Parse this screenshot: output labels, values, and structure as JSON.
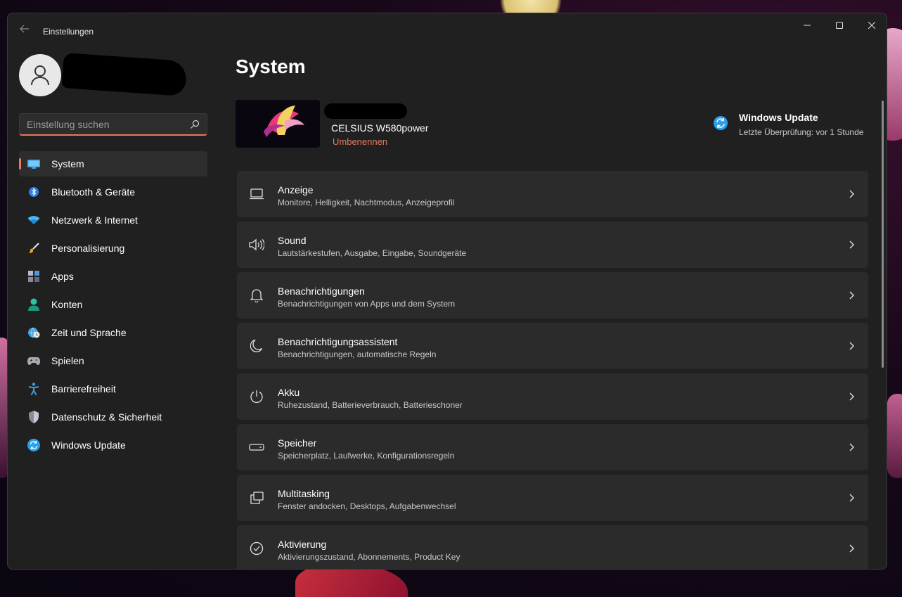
{
  "window": {
    "title": "Einstellungen"
  },
  "sidebar": {
    "search_placeholder": "Einstellung suchen",
    "items": [
      {
        "label": "System",
        "icon": "monitor-icon",
        "active": true
      },
      {
        "label": "Bluetooth & Geräte",
        "icon": "bluetooth-icon"
      },
      {
        "label": "Netzwerk & Internet",
        "icon": "wifi-icon"
      },
      {
        "label": "Personalisierung",
        "icon": "brush-icon"
      },
      {
        "label": "Apps",
        "icon": "apps-icon"
      },
      {
        "label": "Konten",
        "icon": "person-icon"
      },
      {
        "label": "Zeit und Sprache",
        "icon": "globe-clock-icon"
      },
      {
        "label": "Spielen",
        "icon": "gamepad-icon"
      },
      {
        "label": "Barrierefreiheit",
        "icon": "accessibility-icon"
      },
      {
        "label": "Datenschutz & Sicherheit",
        "icon": "shield-icon"
      },
      {
        "label": "Windows Update",
        "icon": "update-icon"
      }
    ]
  },
  "main": {
    "title": "System",
    "device": {
      "model": "CELSIUS W580power",
      "rename_label": "Umbenennen"
    },
    "windows_update": {
      "title": "Windows Update",
      "subtitle": "Letzte Überprüfung: vor 1 Stunde"
    },
    "settings": [
      {
        "title": "Anzeige",
        "subtitle": "Monitore, Helligkeit, Nachtmodus, Anzeigeprofil",
        "icon": "display-icon"
      },
      {
        "title": "Sound",
        "subtitle": "Lautstärkestufen, Ausgabe, Eingabe, Soundgeräte",
        "icon": "speaker-icon"
      },
      {
        "title": "Benachrichtigungen",
        "subtitle": "Benachrichtigungen von Apps und dem System",
        "icon": "bell-icon"
      },
      {
        "title": "Benachrichtigungsassistent",
        "subtitle": "Benachrichtigungen, automatische Regeln",
        "icon": "moon-icon"
      },
      {
        "title": "Akku",
        "subtitle": "Ruhezustand, Batterieverbrauch, Batterieschoner",
        "icon": "power-icon"
      },
      {
        "title": "Speicher",
        "subtitle": "Speicherplatz, Laufwerke, Konfigurationsregeln",
        "icon": "storage-icon"
      },
      {
        "title": "Multitasking",
        "subtitle": "Fenster andocken, Desktops, Aufgabenwechsel",
        "icon": "multitasking-icon"
      },
      {
        "title": "Aktivierung",
        "subtitle": "Aktivierungszustand, Abonnements, Product Key",
        "icon": "check-circle-icon"
      }
    ]
  },
  "colors": {
    "accent": "#e27b5e",
    "window_bg": "#202020",
    "card_bg": "#2b2b2b",
    "update_blue": "#2b9fe8"
  }
}
